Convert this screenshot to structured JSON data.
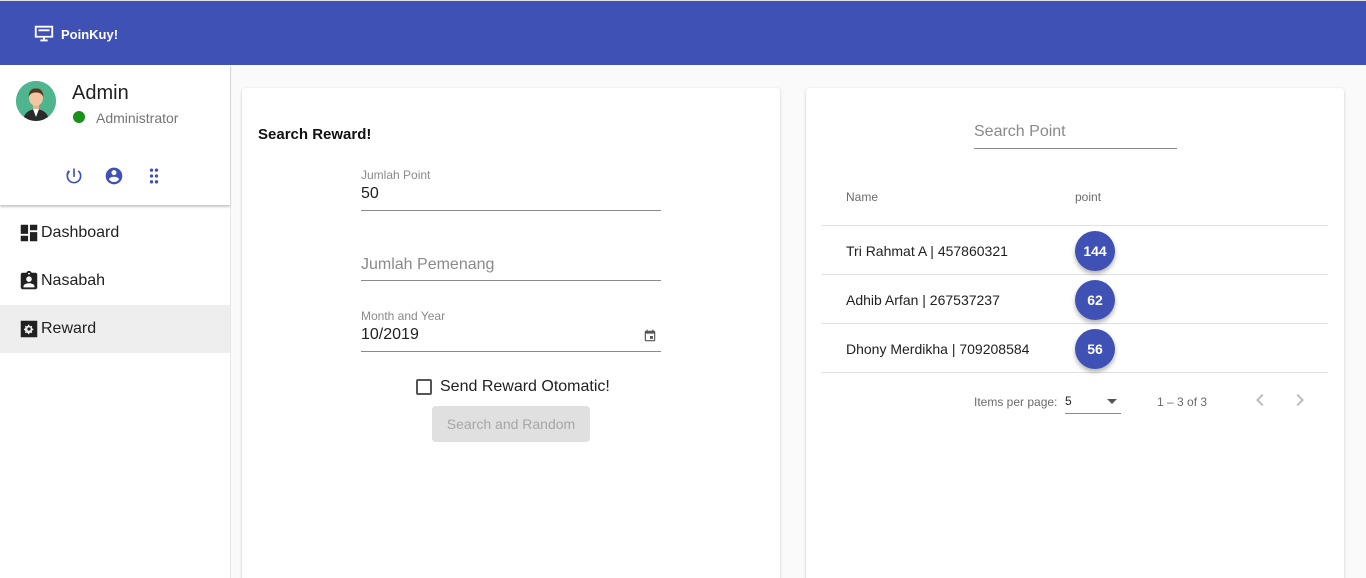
{
  "app": {
    "brand": "PoinKuy!"
  },
  "user": {
    "name": "Admin",
    "role": "Administrator"
  },
  "nav": [
    {
      "label": "Dashboard",
      "icon": "dashboard-icon"
    },
    {
      "label": "Nasabah",
      "icon": "badge-icon"
    },
    {
      "label": "Reward",
      "icon": "gear-icon",
      "active": true
    }
  ],
  "search_form": {
    "title": "Search Reward!",
    "point_label": "Jumlah Point",
    "point_value": "50",
    "winner_placeholder": "Jumlah Pemenang",
    "month_label": "Month and Year",
    "month_value": "10/2019",
    "checkbox_label": "Send Reward Otomatic!",
    "submit_label": "Search and Random"
  },
  "results": {
    "search_placeholder": "Search Point",
    "columns": {
      "name": "Name",
      "point": "point"
    },
    "rows": [
      {
        "name": "Tri Rahmat A | 457860321",
        "point": "144"
      },
      {
        "name": "Adhib Arfan | 267537237",
        "point": "62"
      },
      {
        "name": "Dhony Merdikha | 709208584",
        "point": "56"
      }
    ],
    "paginator": {
      "items_per_page_label": "Items per page:",
      "items_per_page": "5",
      "range": "1 – 3 of 3"
    }
  },
  "colors": {
    "primary": "#3f51b5",
    "status_online": "#1a8f1a",
    "avatar_bg": "#4fb58e"
  }
}
